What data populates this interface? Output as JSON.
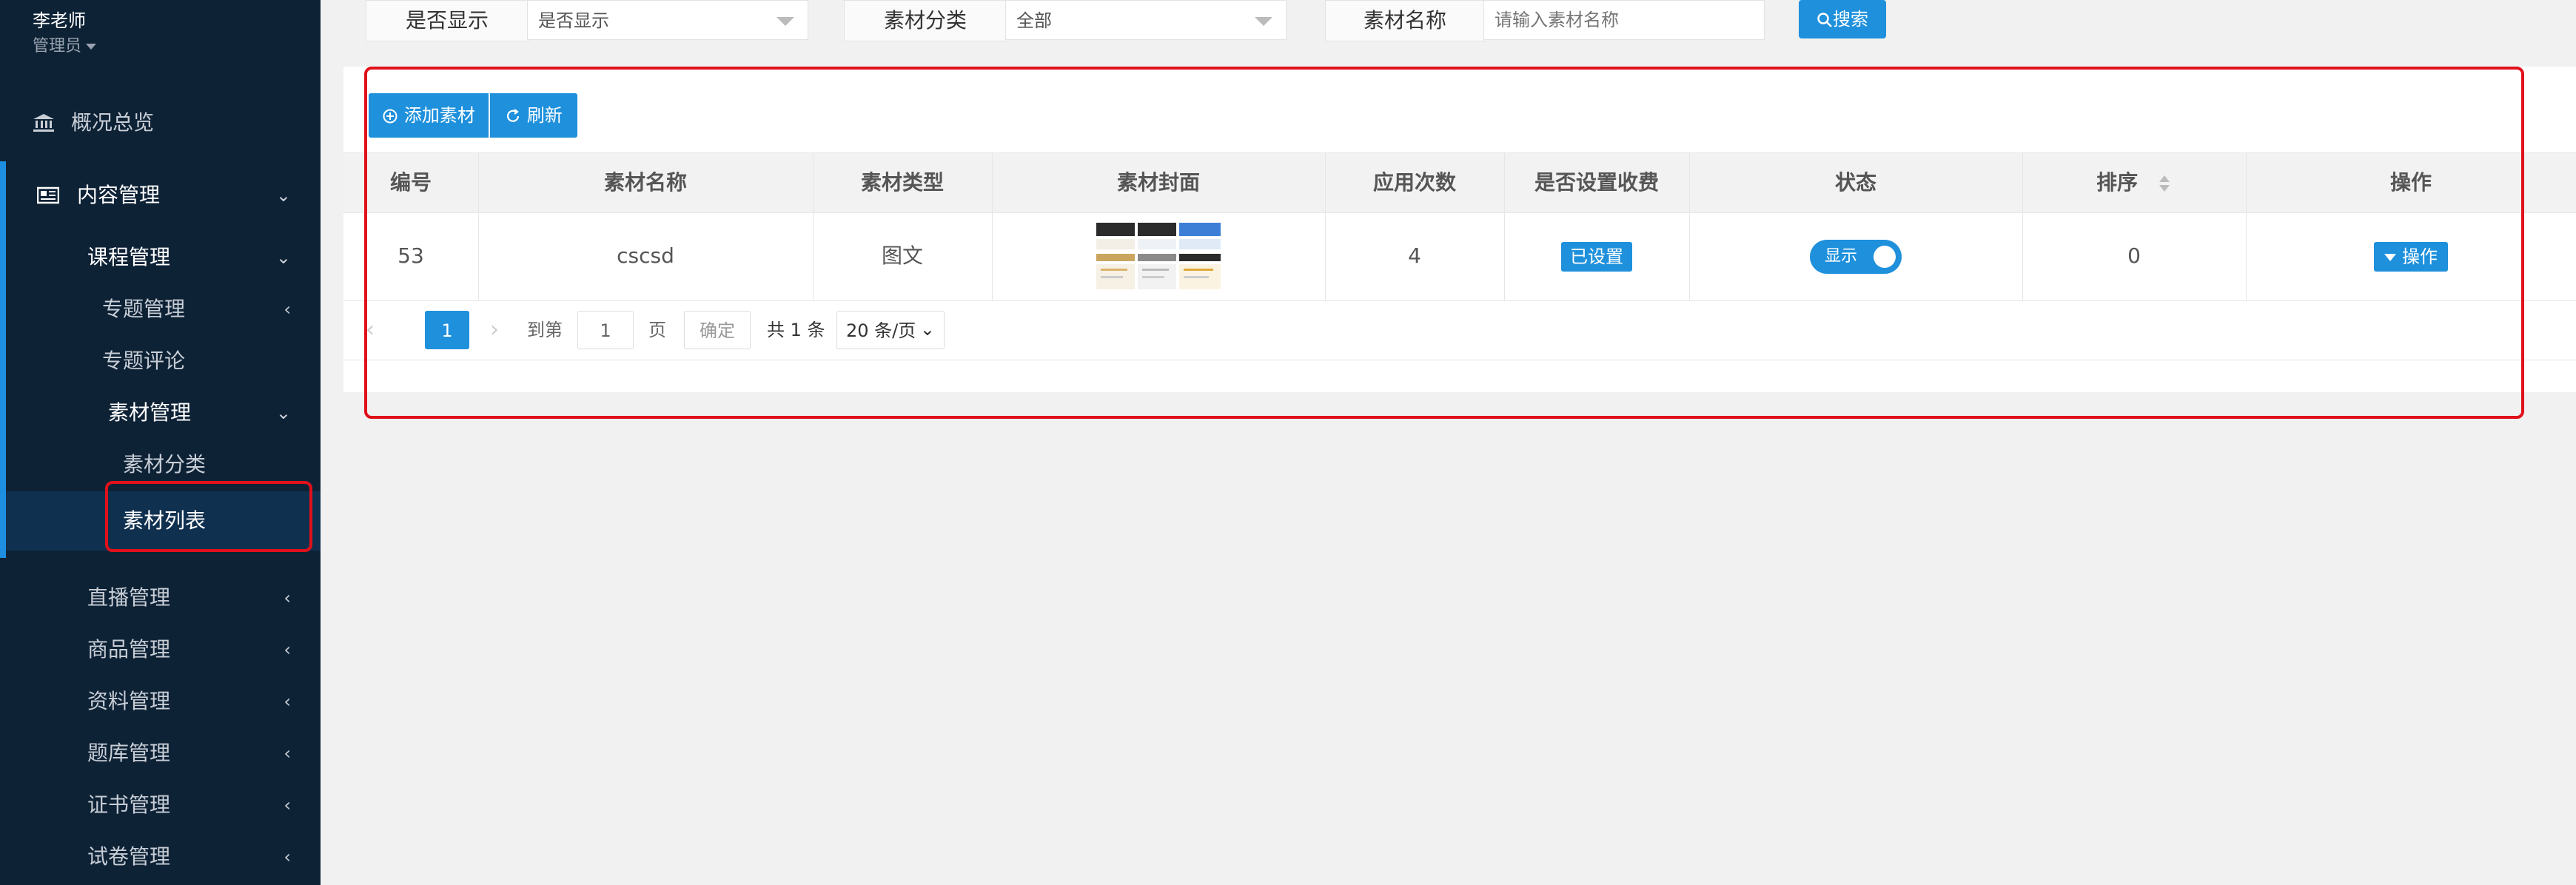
{
  "sidebar": {
    "user_name": "李老师",
    "user_role": "管理员",
    "items": [
      {
        "label": "概况总览",
        "icon": "bank-icon"
      },
      {
        "label": "内容管理",
        "icon": "newspaper-icon"
      },
      {
        "label": "课程管理"
      },
      {
        "label": "专题管理"
      },
      {
        "label": "专题评论"
      },
      {
        "label": "素材管理"
      },
      {
        "label": "素材分类"
      },
      {
        "label": "素材列表"
      },
      {
        "label": "直播管理"
      },
      {
        "label": "商品管理"
      },
      {
        "label": "资料管理"
      },
      {
        "label": "题库管理"
      },
      {
        "label": "证书管理"
      },
      {
        "label": "试卷管理"
      }
    ]
  },
  "filters": {
    "display_label": "是否显示",
    "display_value": "是否显示",
    "category_label": "素材分类",
    "category_value": "全部",
    "name_label": "素材名称",
    "name_placeholder": "请输入素材名称",
    "search_label": "搜索"
  },
  "toolbar": {
    "add_label": "添加素材",
    "refresh_label": "刷新"
  },
  "table": {
    "headers": [
      "编号",
      "素材名称",
      "素材类型",
      "素材封面",
      "应用次数",
      "是否设置收费",
      "状态",
      "排序",
      "操作"
    ],
    "rows": [
      {
        "id": "53",
        "name": "cscsd",
        "type": "图文",
        "uses": "4",
        "fee": "已设置",
        "status": "显示",
        "sort": "0",
        "action": "操作"
      }
    ]
  },
  "pagination": {
    "current_page": "1",
    "goto_label": "到第",
    "goto_value": "1",
    "page_unit": "页",
    "confirm_label": "确定",
    "total_label": "共 1 条",
    "page_size": "20 条/页"
  },
  "colors": {
    "sidebar_bg": "#0e2236",
    "accent": "#1e90dc",
    "highlight": "#e0111b"
  }
}
